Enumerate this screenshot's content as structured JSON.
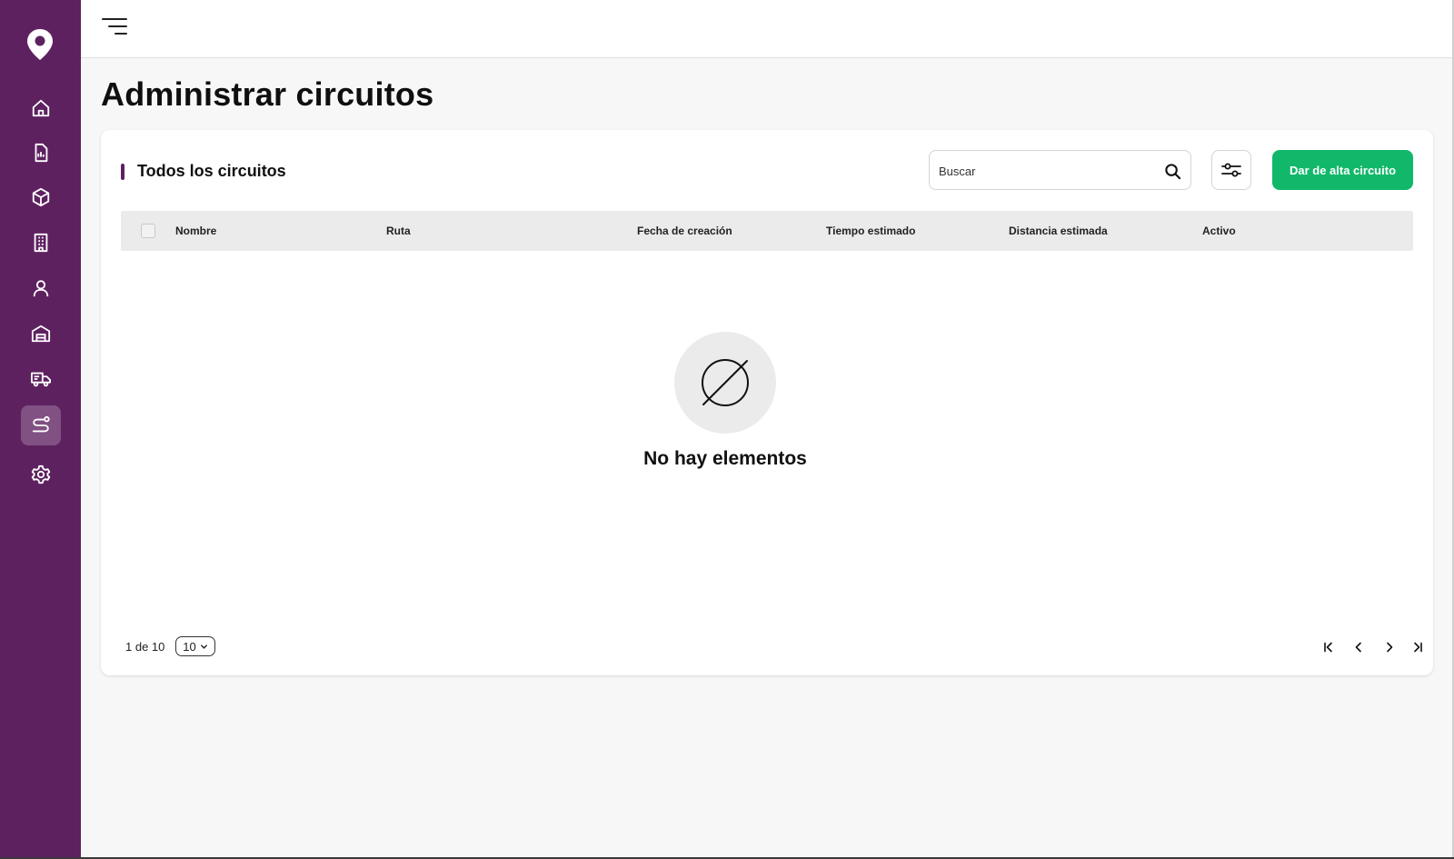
{
  "sidebar": {
    "logo": "map-pin-logo",
    "items": [
      {
        "icon": "home-icon"
      },
      {
        "icon": "report-icon"
      },
      {
        "icon": "package-icon"
      },
      {
        "icon": "building-icon"
      },
      {
        "icon": "user-icon"
      },
      {
        "icon": "warehouse-icon"
      },
      {
        "icon": "truck-icon"
      },
      {
        "icon": "route-icon",
        "active": true
      },
      {
        "icon": "settings-icon"
      }
    ],
    "color": "#5e2160"
  },
  "header": {
    "menu_icon": "hamburger-menu-icon"
  },
  "page": {
    "title": "Administrar circuitos"
  },
  "card": {
    "title": "Todos los circuitos",
    "search": {
      "placeholder": "Buscar",
      "value": ""
    },
    "filter_icon": "filter-sliders-icon",
    "add_button": "Dar de alta circuito",
    "add_button_color": "#12b86a"
  },
  "table": {
    "columns": [
      "Nombre",
      "Ruta",
      "Fecha de creación",
      "Tiempo estimado",
      "Distancia estimada",
      "Activo"
    ],
    "rows": []
  },
  "empty_state": {
    "icon": "empty-set-icon",
    "text": "No hay elementos"
  },
  "pagination": {
    "info": "1 de 10",
    "page_size": "10"
  }
}
